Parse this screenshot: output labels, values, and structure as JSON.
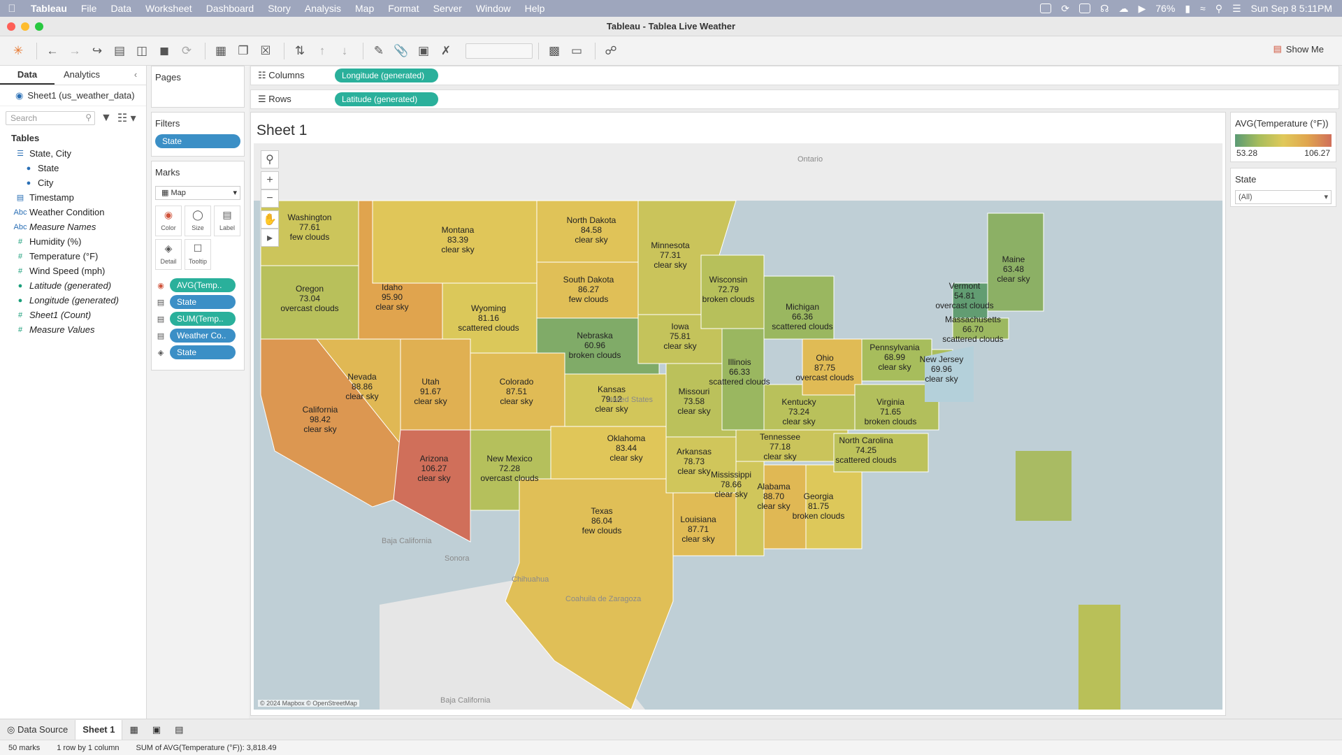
{
  "menubar": {
    "app": "Tableau",
    "items": [
      "File",
      "Data",
      "Worksheet",
      "Dashboard",
      "Story",
      "Analysis",
      "Map",
      "Format",
      "Server",
      "Window",
      "Help"
    ],
    "battery": "76%",
    "datetime": "Sun Sep 8  5:11PM"
  },
  "window": {
    "title": "Tableau - Tablea Live Weather"
  },
  "toolbar": {
    "show_me": "Show Me"
  },
  "left_panel": {
    "tabs": [
      "Data",
      "Analytics"
    ],
    "datasource": "Sheet1 (us_weather_data)",
    "search_placeholder": "Search",
    "tables_header": "Tables",
    "fields": [
      {
        "label": "State, City",
        "kind": "hier"
      },
      {
        "label": "State",
        "kind": "geo",
        "sub": true
      },
      {
        "label": "City",
        "kind": "geo",
        "sub": true
      },
      {
        "label": "Timestamp",
        "kind": "date"
      },
      {
        "label": "Weather Condition",
        "kind": "abc"
      },
      {
        "label": "Measure Names",
        "kind": "abc",
        "italic": true
      },
      {
        "label": "Humidity (%)",
        "kind": "num"
      },
      {
        "label": "Temperature (°F)",
        "kind": "num"
      },
      {
        "label": "Wind Speed (mph)",
        "kind": "num"
      },
      {
        "label": "Latitude (generated)",
        "kind": "geo2",
        "italic": true
      },
      {
        "label": "Longitude (generated)",
        "kind": "geo2",
        "italic": true
      },
      {
        "label": "Sheet1 (Count)",
        "kind": "num",
        "italic": true
      },
      {
        "label": "Measure Values",
        "kind": "num",
        "italic": true
      }
    ]
  },
  "cards": {
    "pages": "Pages",
    "filters": "Filters",
    "filter_pill": "State",
    "marks": "Marks",
    "mark_type": "Map",
    "mark_buttons": [
      "Color",
      "Size",
      "Label",
      "Detail",
      "Tooltip"
    ],
    "mark_pills": [
      "AVG(Temp..",
      "State",
      "SUM(Temp..",
      "Weather Co..",
      "State"
    ]
  },
  "shelves": {
    "columns_label": "Columns",
    "columns_pill": "Longitude (generated)",
    "rows_label": "Rows",
    "rows_pill": "Latitude (generated)"
  },
  "sheet": {
    "title": "Sheet 1"
  },
  "map_labels": [
    {
      "name": "Washington",
      "temp": "77.61",
      "cond": "few clouds"
    },
    {
      "name": "Oregon",
      "temp": "73.04",
      "cond": "overcast clouds"
    },
    {
      "name": "California",
      "temp": "98.42",
      "cond": "clear sky"
    },
    {
      "name": "Idaho",
      "temp": "95.90",
      "cond": "clear sky"
    },
    {
      "name": "Nevada",
      "temp": "88.86",
      "cond": "clear sky"
    },
    {
      "name": "Montana",
      "temp": "83.39",
      "cond": "clear sky"
    },
    {
      "name": "Wyoming",
      "temp": "81.16",
      "cond": "scattered clouds"
    },
    {
      "name": "Utah",
      "temp": "91.67",
      "cond": "clear sky"
    },
    {
      "name": "Arizona",
      "temp": "106.27",
      "cond": "clear sky"
    },
    {
      "name": "Colorado",
      "temp": "87.51",
      "cond": "clear sky"
    },
    {
      "name": "New Mexico",
      "temp": "72.28",
      "cond": "overcast clouds"
    },
    {
      "name": "North Dakota",
      "temp": "84.58",
      "cond": "clear sky"
    },
    {
      "name": "South Dakota",
      "temp": "86.27",
      "cond": "few clouds"
    },
    {
      "name": "Nebraska",
      "temp": "60.96",
      "cond": "broken clouds"
    },
    {
      "name": "Kansas",
      "temp": "79.12",
      "cond": "clear sky"
    },
    {
      "name": "Oklahoma",
      "temp": "83.44",
      "cond": "clear sky"
    },
    {
      "name": "Texas",
      "temp": "86.04",
      "cond": "few clouds"
    },
    {
      "name": "Minnesota",
      "temp": "77.31",
      "cond": "clear sky"
    },
    {
      "name": "Iowa",
      "temp": "75.81",
      "cond": "clear sky"
    },
    {
      "name": "Missouri",
      "temp": "73.58",
      "cond": "clear sky"
    },
    {
      "name": "Arkansas",
      "temp": "78.73",
      "cond": "clear sky"
    },
    {
      "name": "Louisiana",
      "temp": "87.71",
      "cond": "clear sky"
    },
    {
      "name": "Wisconsin",
      "temp": "72.79",
      "cond": "broken clouds"
    },
    {
      "name": "Illinois",
      "temp": "66.33",
      "cond": "scattered clouds"
    },
    {
      "name": "Michigan",
      "temp": "66.36",
      "cond": "scattered clouds"
    },
    {
      "name": "Mississippi",
      "temp": "78.66",
      "cond": "clear sky"
    },
    {
      "name": "Alabama",
      "temp": "88.70",
      "cond": "clear sky"
    },
    {
      "name": "Tennessee",
      "temp": "77.18",
      "cond": "clear sky"
    },
    {
      "name": "Kentucky",
      "temp": "73.24",
      "cond": "clear sky"
    },
    {
      "name": "Ohio",
      "temp": "87.75",
      "cond": "overcast clouds"
    },
    {
      "name": "Georgia",
      "temp": "81.75",
      "cond": "broken clouds"
    },
    {
      "name": "North Carolina",
      "temp": "74.25",
      "cond": "scattered clouds"
    },
    {
      "name": "Virginia",
      "temp": "71.65",
      "cond": "broken clouds"
    },
    {
      "name": "Pennsylvania",
      "temp": "68.99",
      "cond": "clear sky"
    },
    {
      "name": "New Jersey",
      "temp": "69.96",
      "cond": "clear sky"
    },
    {
      "name": "Vermont",
      "temp": "54.81",
      "cond": "overcast clouds"
    },
    {
      "name": "Massachusetts",
      "temp": "66.70",
      "cond": "scattered clouds"
    },
    {
      "name": "Maine",
      "temp": "63.48",
      "cond": "clear sky"
    }
  ],
  "basemap_labels": [
    "Ontario",
    "United States",
    "Baja California",
    "Sonora",
    "Chihuahua",
    "Coahuila de Zaragoza",
    "Baja California"
  ],
  "copyright": "© 2024 Mapbox © OpenStreetMap",
  "legend": {
    "title": "AVG(Temperature (°F))",
    "min": "53.28",
    "max": "106.27"
  },
  "state_filter": {
    "title": "State",
    "value": "(All)"
  },
  "tabs": {
    "data_source": "Data Source",
    "sheet": "Sheet 1"
  },
  "status": {
    "marks": "50 marks",
    "rows": "1 row by 1 column",
    "sum": "SUM of AVG(Temperature (°F)): 3,818.49"
  }
}
